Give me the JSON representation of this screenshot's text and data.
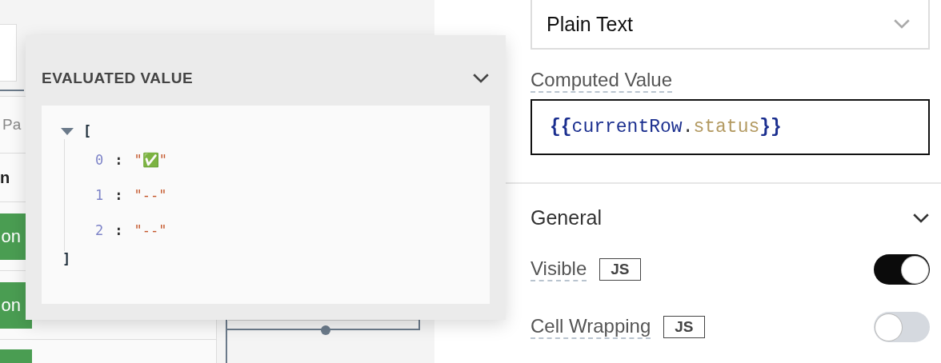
{
  "canvas": {
    "tab_fragment": "Pa",
    "column_fragment": "n",
    "buttons": [
      {
        "kind": "button",
        "label": "on"
      },
      {
        "kind": "button",
        "label": "on"
      },
      {
        "kind": "sliver"
      }
    ]
  },
  "evaluated_value": {
    "title": "EVALUATED VALUE",
    "expanded": true,
    "open_bracket": "[",
    "close_bracket": "]",
    "items": [
      {
        "index": "0",
        "separator": ":",
        "value": "\"✅\""
      },
      {
        "index": "1",
        "separator": ":",
        "value": "\"--\""
      },
      {
        "index": "2",
        "separator": ":",
        "value": "\"--\""
      }
    ]
  },
  "column_type": {
    "value": "Plain Text"
  },
  "computed_value": {
    "label": "Computed Value",
    "code": [
      {
        "kind": "brace",
        "text": "{{"
      },
      {
        "kind": "object",
        "text": "currentRow"
      },
      {
        "kind": "punct",
        "text": "."
      },
      {
        "kind": "property",
        "text": "status"
      },
      {
        "kind": "brace",
        "text": "}}"
      }
    ]
  },
  "general": {
    "title": "General",
    "expanded": true,
    "settings": [
      {
        "label": "Visible",
        "badge": "JS",
        "on": true
      },
      {
        "label": "Cell Wrapping",
        "badge": "JS",
        "on": false
      }
    ]
  }
}
